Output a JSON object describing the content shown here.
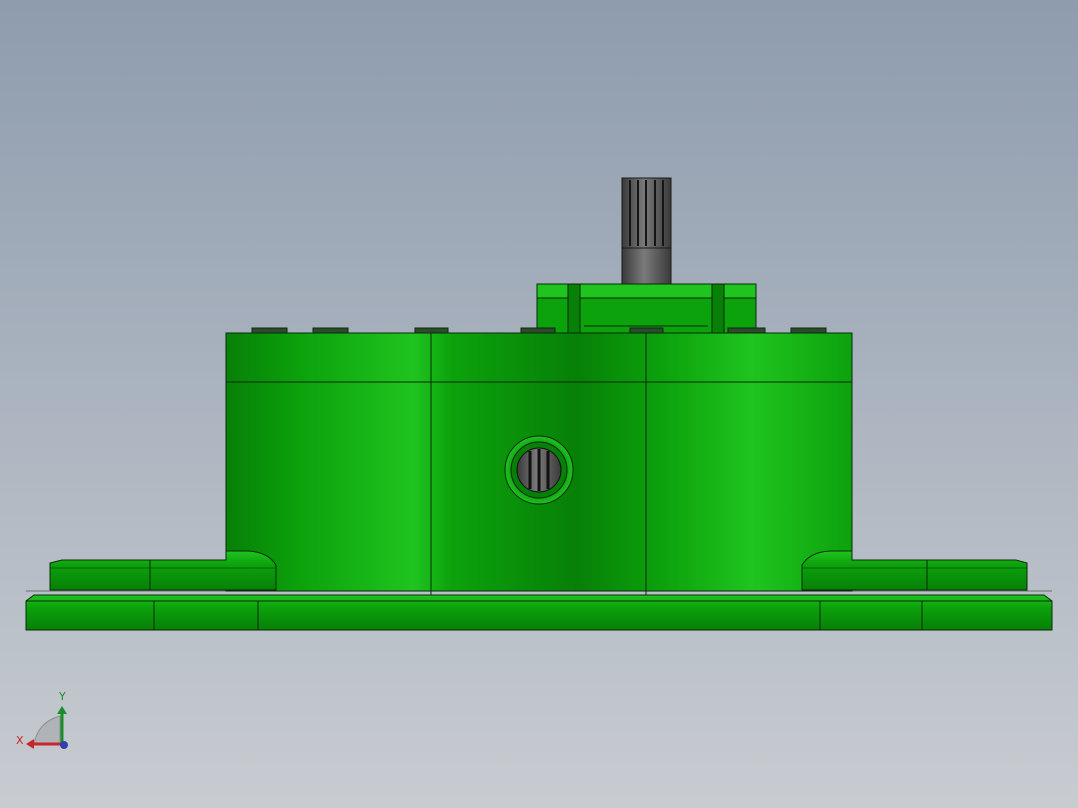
{
  "viewport": {
    "background_top": "#8e9cae",
    "background_bottom": "#c8ccd1"
  },
  "model": {
    "body_color": "#0ca20c",
    "body_highlight": "#1fc41f",
    "body_shadow": "#078007",
    "edge_color": "#0a2a0a",
    "shaft_color": "#3a3a3a",
    "shaft_highlight": "#7a7a7a",
    "bolt_color": "#2d4a2d"
  },
  "triad": {
    "x_label": "X",
    "y_label": "Y",
    "x_color": "#c8262b",
    "y_color": "#1b8e2a",
    "z_color": "#2f3fb0"
  }
}
